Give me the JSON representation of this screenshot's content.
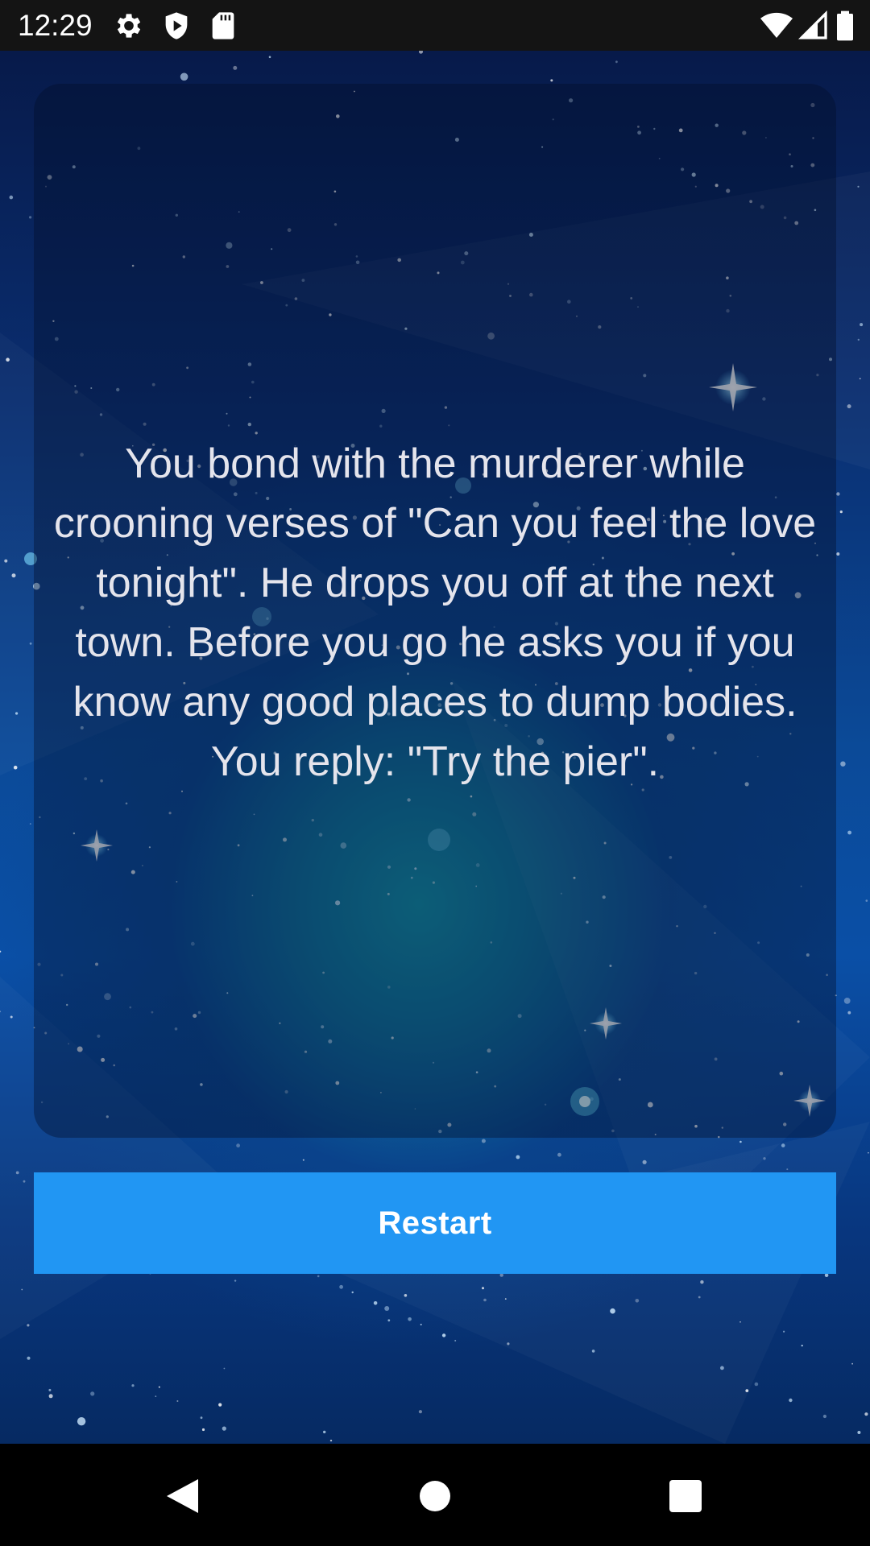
{
  "status_bar": {
    "time": "12:29",
    "left_icons": [
      "gear-icon",
      "shield-icon",
      "sd-card-icon"
    ],
    "right_icons": [
      "wifi-icon",
      "cell-signal-icon",
      "battery-icon"
    ]
  },
  "story": {
    "text": "You bond with the murderer while crooning verses of \"Can you feel the love tonight\". He drops you off at the next town. Before you go he asks you if you know any good places to dump bodies. You reply: \"Try the pier\"."
  },
  "actions": {
    "restart_label": "Restart"
  },
  "nav_bar": {
    "buttons": [
      "back-icon",
      "home-icon",
      "recents-icon"
    ]
  },
  "colors": {
    "status_bar": "#141414",
    "button": "#2196f3",
    "nav_bar": "#000000",
    "story_text": "#e4e4ec"
  }
}
